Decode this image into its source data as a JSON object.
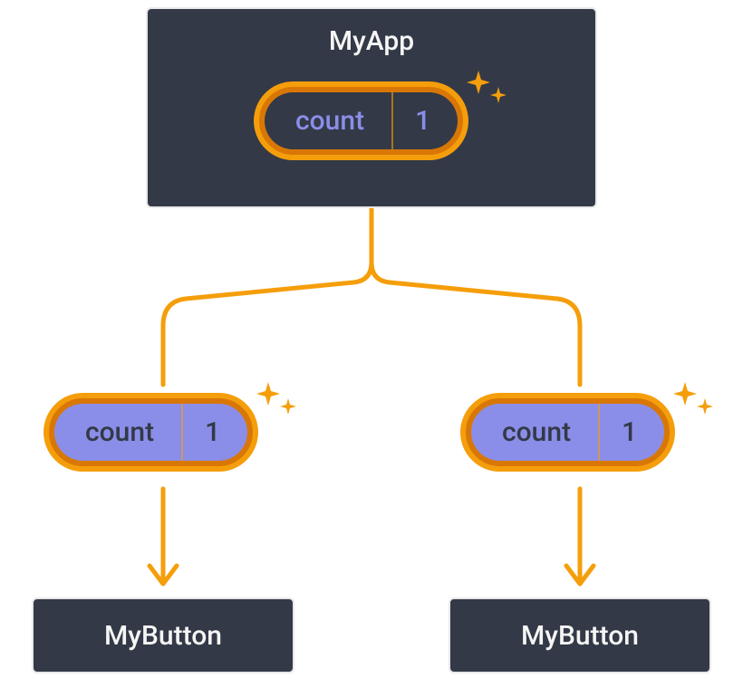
{
  "colors": {
    "box_bg": "#333947",
    "box_border": "#e8e8e8",
    "accent_orange": "#f59e0b",
    "accent_orange_dark": "#d97706",
    "accent_purple": "#8a8ee8",
    "text_light": "#f5f5f5"
  },
  "root": {
    "title": "MyApp",
    "state": {
      "label": "count",
      "value": "1"
    }
  },
  "props": [
    {
      "label": "count",
      "value": "1"
    },
    {
      "label": "count",
      "value": "1"
    }
  ],
  "children": [
    {
      "title": "MyButton"
    },
    {
      "title": "MyButton"
    }
  ],
  "sparkle_icon_name": "sparkle-icon"
}
